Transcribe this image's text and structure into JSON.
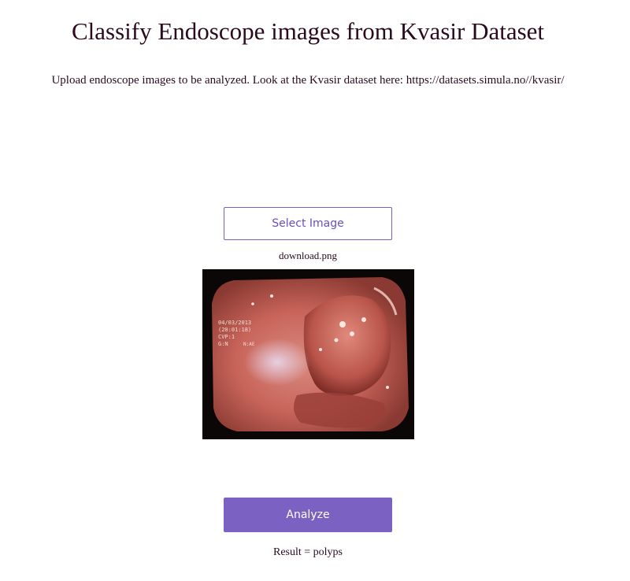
{
  "header": {
    "title": "Classify Endoscope images from Kvasir Dataset",
    "subtitle": "Upload endoscope images to be analyzed. Look at the Kvasir dataset here: https://datasets.simula.no//kvasir/"
  },
  "upload": {
    "select_label": "Select Image",
    "file_name": "download.png"
  },
  "preview": {
    "overlay_date": "04/03/2013",
    "overlay_code": "(20:01:18)",
    "overlay_cvp": "CVP:1",
    "overlay_gn": "G:N",
    "overlay_extra": "N:AE",
    "colors": {
      "background": "#0b0707",
      "tissue": "#c8645a",
      "highlight": "#f4c2b8"
    }
  },
  "actions": {
    "analyze_label": "Analyze"
  },
  "result": {
    "text": "Result = polyps"
  },
  "theme": {
    "accent": "#7b61c2",
    "text": "#2a0a1e"
  }
}
